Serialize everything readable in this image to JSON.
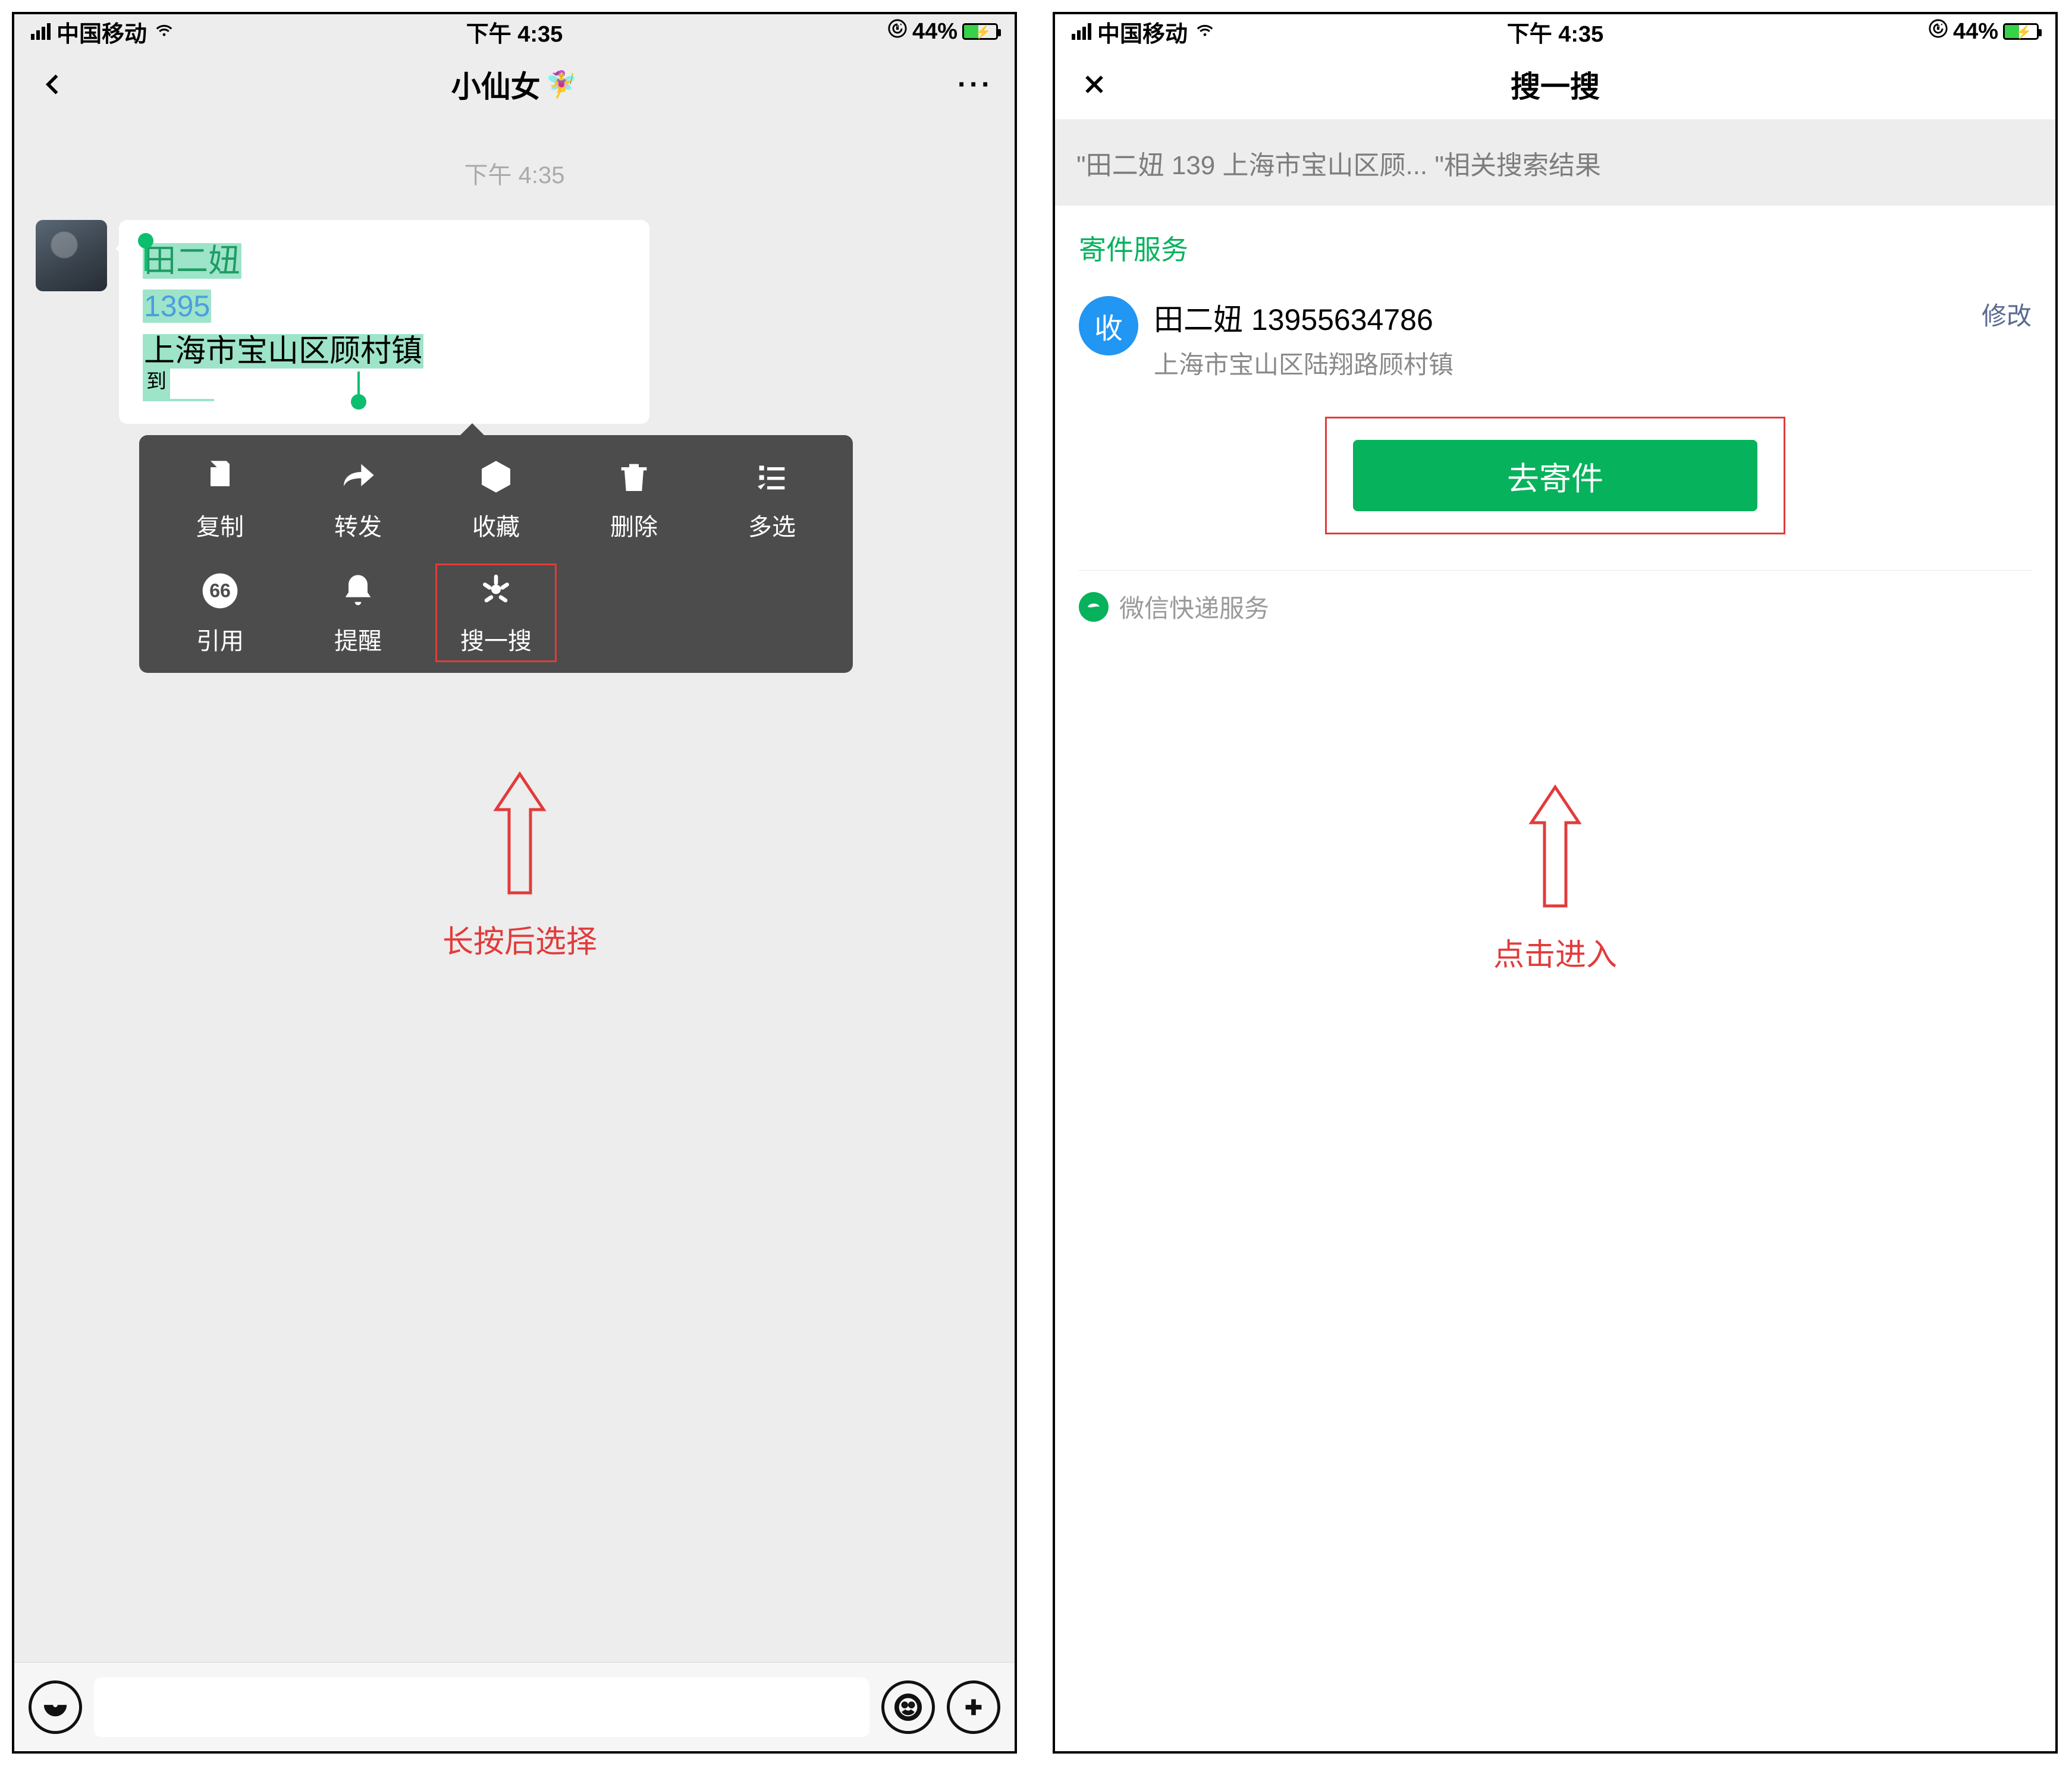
{
  "status": {
    "carrier": "中国移动",
    "time": "下午 4:35",
    "battery_pct": "44%"
  },
  "left": {
    "nav_title": "小仙女",
    "timestamp": "下午 4:35",
    "message": {
      "line1": "田二妞",
      "line2_prefix": "1395",
      "line3": "上海市宝山区顾村镇",
      "tail": "到"
    },
    "ctx": {
      "copy": "复制",
      "forward": "转发",
      "favorite": "收藏",
      "delete": "删除",
      "multiselect": "多选",
      "quote": "引用",
      "remind": "提醒",
      "search": "搜一搜"
    },
    "annotation": "长按后选择"
  },
  "right": {
    "nav_title": "搜一搜",
    "search_summary": "\"田二妞 139                  上海市宝山区顾... \"相关搜索结果",
    "section_title": "寄件服务",
    "badge": "收",
    "contact_name": "田二妞 13955634786",
    "contact_addr": "上海市宝山区陆翔路顾村镇",
    "edit": "修改",
    "ship_button": "去寄件",
    "provider": "微信快递服务",
    "annotation": "点击进入"
  }
}
